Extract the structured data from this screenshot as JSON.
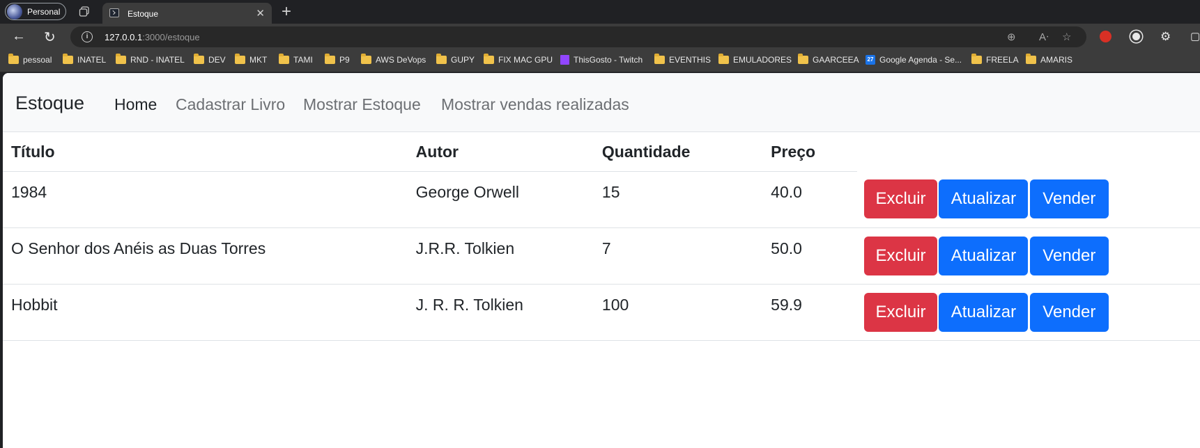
{
  "browser": {
    "profile_label": "Personal",
    "tab_title": "Estoque",
    "url_host": "127.0.0.1",
    "url_rest": ":3000/estoque",
    "bookmarks": [
      "pessoal",
      "INATEL",
      "RND - INATEL",
      "DEV",
      "MKT",
      "TAMI",
      "P9",
      "AWS DeVops",
      "GUPY",
      "FIX MAC GPU",
      "ThisGosto - Twitch",
      "EVENTHIS",
      "EMULADORES",
      "GAARCEEA",
      "Google Agenda - Se...",
      "FREELA",
      "AMARIS"
    ]
  },
  "navbar": {
    "brand": "Estoque",
    "links": [
      "Home",
      "Cadastrar Livro",
      "Mostrar Estoque",
      "Mostrar vendas realizadas"
    ]
  },
  "table": {
    "headers": [
      "Título",
      "Autor",
      "Quantidade",
      "Preço"
    ],
    "rows": [
      {
        "titulo": "1984",
        "autor": "George Orwell",
        "quantidade": "15",
        "preco": "40.0"
      },
      {
        "titulo": "O Senhor dos Anéis as Duas Torres",
        "autor": "J.R.R. Tolkien",
        "quantidade": "7",
        "preco": "50.0"
      },
      {
        "titulo": "Hobbit",
        "autor": "J. R. R. Tolkien",
        "quantidade": "100",
        "preco": "59.9"
      }
    ],
    "actions": {
      "delete": "Excluir",
      "update": "Atualizar",
      "sell": "Vender"
    }
  },
  "colors": {
    "danger": "#dc3545",
    "primary": "#0d6efd"
  }
}
